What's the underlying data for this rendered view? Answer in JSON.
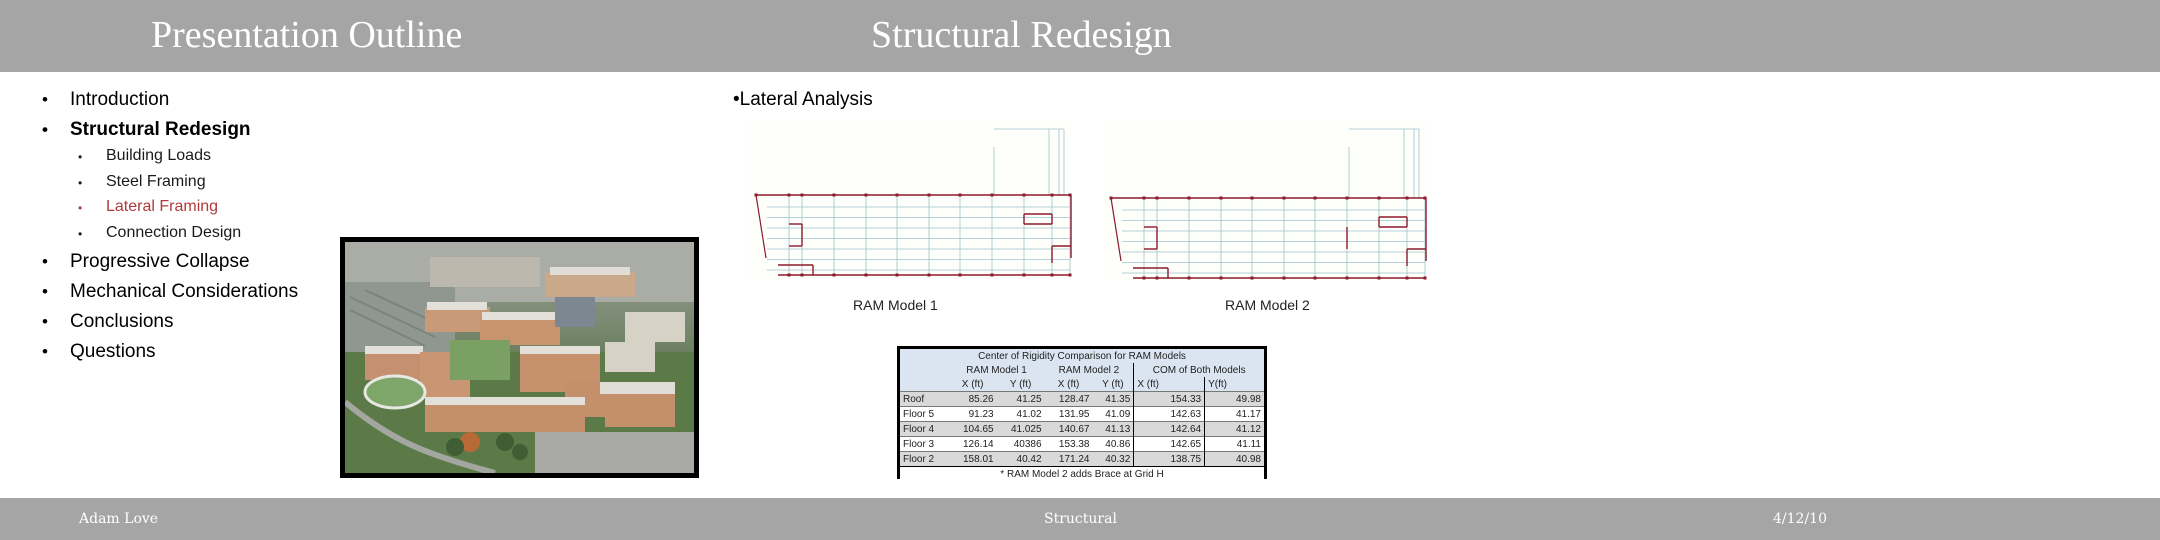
{
  "slide": {
    "left_title": "Presentation Outline",
    "right_title": "Structural Redesign",
    "outline": [
      {
        "label": "Introduction",
        "level": 1,
        "state": "normal"
      },
      {
        "label": "Structural Redesign",
        "level": 1,
        "state": "bold"
      },
      {
        "label": "Building Loads",
        "level": 2,
        "state": "normal"
      },
      {
        "label": "Steel Framing",
        "level": 2,
        "state": "normal"
      },
      {
        "label": "Lateral Framing",
        "level": 2,
        "state": "active"
      },
      {
        "label": "Connection Design",
        "level": 2,
        "state": "normal"
      },
      {
        "label": "Progressive Collapse",
        "level": 1,
        "state": "normal"
      },
      {
        "label": "Mechanical Considerations",
        "level": 1,
        "state": "normal"
      },
      {
        "label": "Conclusions",
        "level": 1,
        "state": "normal"
      },
      {
        "label": "Questions",
        "level": 1,
        "state": "normal"
      }
    ],
    "bullet": "•",
    "section_heading": "•Lateral Analysis",
    "ram_models": [
      {
        "caption": "RAM Model 1"
      },
      {
        "caption": "RAM Model 2"
      }
    ],
    "table": {
      "caption": "Center of Rigidity Comparison for RAM Models",
      "groups": [
        "RAM Model 1",
        "RAM Model 2",
        "COM of Both Models"
      ],
      "subheaders": [
        "X (ft)",
        "Y (ft)",
        "X (ft)",
        "Y (ft)",
        "X (ft)",
        "Y(ft)"
      ],
      "rows": [
        {
          "label": "Roof",
          "values": [
            "85.26",
            "41.25",
            "128.47",
            "41.35",
            "154.33",
            "49.98"
          ]
        },
        {
          "label": "Floor 5",
          "values": [
            "91.23",
            "41.02",
            "131.95",
            "41.09",
            "142.63",
            "41.17"
          ]
        },
        {
          "label": "Floor 4",
          "values": [
            "104.65",
            "41.025",
            "140.67",
            "41.13",
            "142.64",
            "41.12"
          ]
        },
        {
          "label": "Floor 3",
          "values": [
            "126.14",
            "40386",
            "153.38",
            "40.86",
            "142.65",
            "41.11"
          ]
        },
        {
          "label": "Floor 2",
          "values": [
            "158.01",
            "40.42",
            "171.24",
            "40.32",
            "138.75",
            "40.98"
          ]
        }
      ],
      "note": "* RAM Model 2 adds Brace at Grid H"
    },
    "footer": {
      "author": "Adam Love",
      "topic": "Structural",
      "date": "4/12/10"
    },
    "colors": {
      "bar": "#a5a5a5",
      "active": "#b03a3a",
      "frame_red": "#8b1a2b",
      "grid_blue": "#9fc3cc",
      "table_header": "#dbe5f1",
      "table_shade": "#d9d9d9"
    }
  }
}
